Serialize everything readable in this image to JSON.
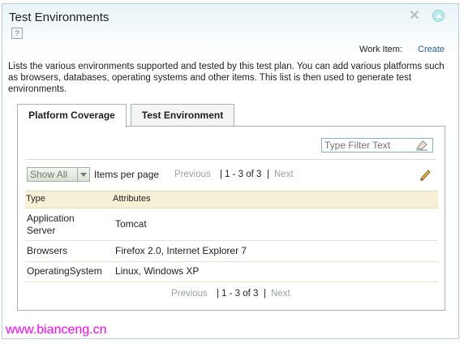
{
  "panel": {
    "title": "Test Environments",
    "help_glyph": "?"
  },
  "header": {
    "work_item_label": "Work Item:",
    "create_link": "Create"
  },
  "description": "Lists the various environments supported and tested by this test plan. You can add various platforms such as browsers, databases, operating systems and other items. This list is then used to generate test environments.",
  "tabs": [
    {
      "label": "Platform Coverage",
      "selected": true
    },
    {
      "label": "Test Environment",
      "selected": false
    }
  ],
  "filter": {
    "placeholder": "Type Filter Text"
  },
  "toolbar": {
    "show_selected": "Show All",
    "items_per_page": "Items per page"
  },
  "pager": {
    "previous": "Previous",
    "separator": "|",
    "range": "1 - 3 of 3",
    "next": "Next"
  },
  "table": {
    "columns": [
      "Type",
      "Attributes"
    ],
    "rows": [
      {
        "type": "Application Server",
        "attributes": "Tomcat"
      },
      {
        "type": "Browsers",
        "attributes": "Firefox 2.0, Internet Explorer 7"
      },
      {
        "type": "OperatingSystem",
        "attributes": "Linux, Windows XP"
      }
    ]
  },
  "watermark": "www.bianceng.cn",
  "colors": {
    "link": "#1f5f9f",
    "table_header_bg": "#f6f1d6",
    "disabled_text": "#9aa2a8",
    "watermark": "#ff00ff"
  }
}
